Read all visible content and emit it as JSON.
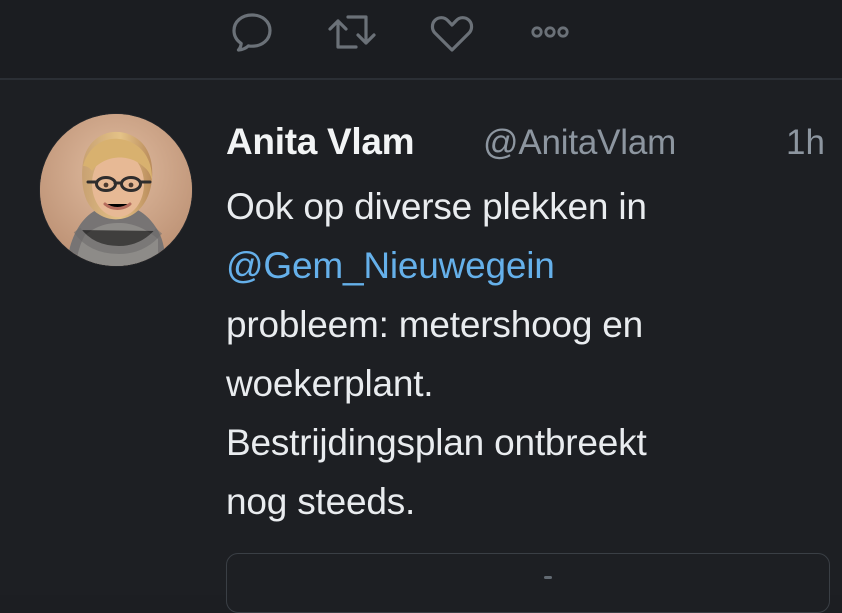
{
  "previous_tweet_actions": {
    "reply_icon": "speech-bubble-icon",
    "retweet_icon": "retweet-arrows-icon",
    "like_icon": "heart-outline-icon",
    "more_icon": "three-dots-icon"
  },
  "tweet": {
    "author": {
      "name": "Anita Vlam",
      "handle": "@AnitaVlam",
      "avatar": "profile-photo"
    },
    "time": "1h",
    "text": {
      "line1": "Ook op diverse plekken in",
      "mention": "@Gem_Nieuwegein",
      "line3": "probleem: metershoog en",
      "line4": "woekerplant.",
      "line5": "Bestrijdingsplan ontbreekt",
      "line6": "nog steeds."
    }
  },
  "colors": {
    "background": "#1d1f23",
    "text": "#e9ecef",
    "secondary_text": "#8d96a0",
    "mention": "#65b0ea",
    "divider": "#2b2f35"
  }
}
